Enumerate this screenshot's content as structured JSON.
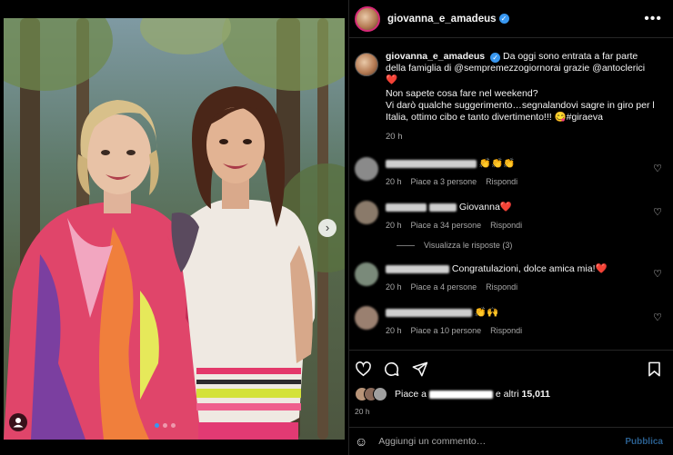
{
  "post": {
    "username": "giovanna_e_amadeus",
    "more_label": "•••",
    "caption_line1": " Da oggi sono entrata a far parte della famiglia di @sempremezzogiornorai grazie @antoclerici ❤️",
    "caption_line2": "Non sapete cosa fare nel weekend?",
    "caption_line3": "Vi darò qualche suggerimento…segnalandovi sagre in giro per l Italia, ottimo cibo e tanto divertimento!!! 😋#giraeva",
    "caption_time": "20 h"
  },
  "comments": [
    {
      "text": "👏👏👏",
      "time": "20 h",
      "likes": "Piace a 3 persone",
      "reply": "Rispondi"
    },
    {
      "text": "Giovanna❤️",
      "time": "20 h",
      "likes": "Piace a 34 persone",
      "reply": "Rispondi"
    },
    {
      "text": "Congratulazioni, dolce amica mia!❤️",
      "time": "20 h",
      "likes": "Piace a 4 persone",
      "reply": "Rispondi"
    },
    {
      "text": "👏🙌",
      "time": "20 h",
      "likes": "Piace a 10 persone",
      "reply": "Rispondi"
    }
  ],
  "view_replies": "Visualizza le risposte (3)",
  "likes": {
    "prefix": "Piace a",
    "suffix": "e altri",
    "count": "15,011"
  },
  "post_time": "20 h",
  "add_comment": {
    "placeholder": "Aggiungi un commento…",
    "publish": "Pubblica"
  },
  "carousel": {
    "slides": 3,
    "active": 1,
    "next_label": "›"
  },
  "icons": [
    "heart-icon",
    "comment-icon",
    "share-icon",
    "bookmark-icon",
    "emoji-icon",
    "verified-icon",
    "user-tag-icon",
    "next-slide-icon"
  ],
  "colors": {
    "accent": "#3897f0",
    "background": "#000000",
    "muted": "#a8a8a8"
  }
}
